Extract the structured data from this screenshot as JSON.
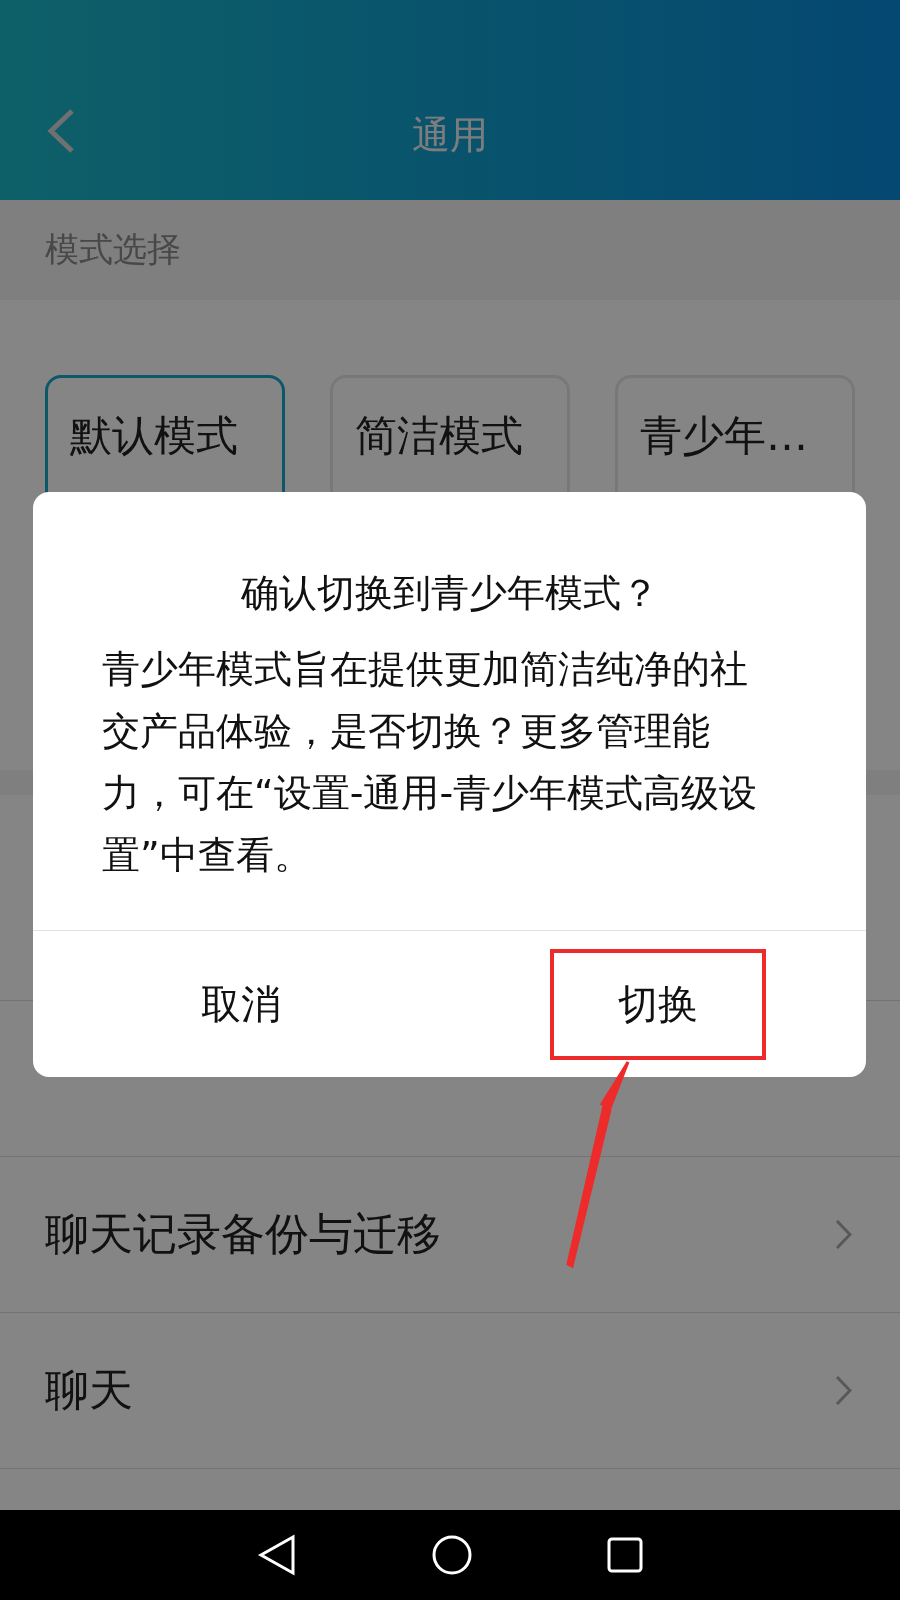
{
  "header": {
    "title": "通用"
  },
  "section": {
    "label": "模式选择"
  },
  "modes": [
    {
      "title": "默认模式",
      "selected": true
    },
    {
      "title": "简洁模式",
      "selected": false
    },
    {
      "title": "青少年…",
      "selected": false
    }
  ],
  "rows": [
    {
      "label": "聊天记录备份与迁移"
    },
    {
      "label": "聊天"
    }
  ],
  "dialog": {
    "title": "确认切换到青少年模式？",
    "message": "青少年模式旨在提供更加简洁纯净的社交产品体验，是否切换？更多管理能力，可在“设置-通用-青少年模式高级设置”中查看。",
    "buttons": [
      {
        "label": "取消",
        "highlighted": false
      },
      {
        "label": "切换",
        "highlighted": true
      }
    ]
  }
}
